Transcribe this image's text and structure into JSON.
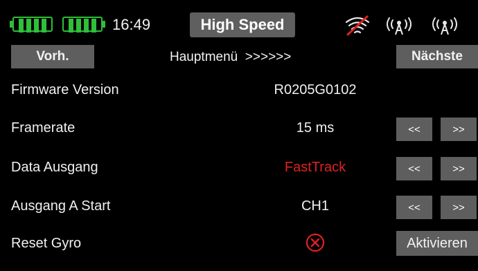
{
  "status_bar": {
    "time": "16:49",
    "mode": "High Speed",
    "icons": [
      "battery-icon",
      "battery-icon",
      "wifi-off-icon",
      "antenna-icon",
      "antenna-icon"
    ],
    "colors": {
      "battery": "#2fbf3a",
      "wifi_off_slash": "#e02020"
    }
  },
  "header": {
    "prev_label": "Vorh.",
    "title": "Hauptmenü  >>>>>>",
    "next_label": "Nächste"
  },
  "rows": [
    {
      "label": "Firmware Version",
      "value": "R0205G0102"
    },
    {
      "label": "Framerate",
      "value": "15 ms",
      "prev": "<<",
      "next": ">>"
    },
    {
      "label": "Data Ausgang",
      "value": "FastTrack",
      "value_color": "#e02020",
      "prev": "<<",
      "next": ">>"
    },
    {
      "label": "Ausgang A Start",
      "value": "CH1",
      "prev": "<<",
      "next": ">>"
    },
    {
      "label": "Reset Gyro",
      "value_icon": "close-circle-icon",
      "action": "Aktivieren"
    }
  ]
}
